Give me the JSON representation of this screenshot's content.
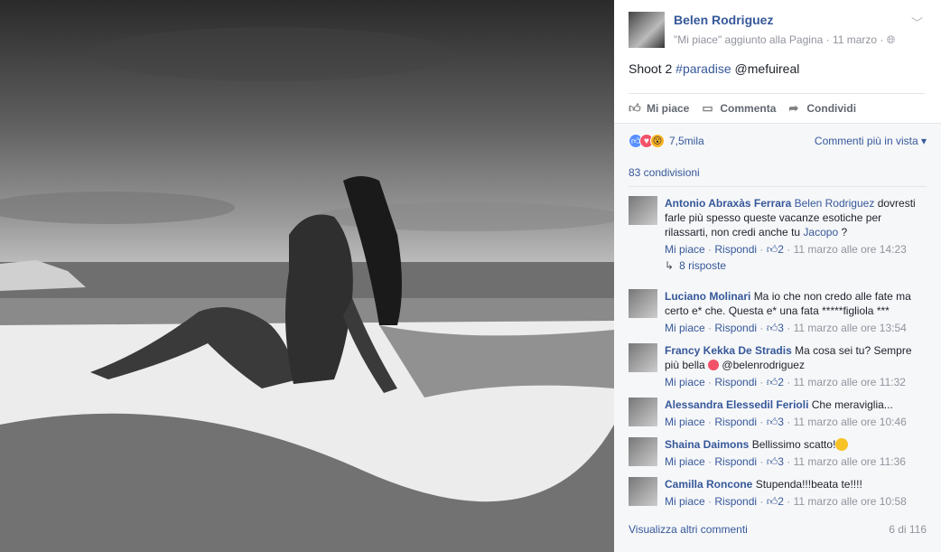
{
  "post": {
    "author": "Belen Rodriguez",
    "meta": "\"Mi piace\" aggiunto alla Pagina · 11 marzo · ",
    "text_prefix": "Shoot 2 ",
    "hashtag": "#paradise",
    "mention": " @mefuireal"
  },
  "actions": {
    "like": "Mi piace",
    "comment": "Commenta",
    "share": "Condividi"
  },
  "reactions": {
    "count": "7,5mila",
    "sort": "Commenti più in vista ▾"
  },
  "shares": "83 condivisioni",
  "comments": [
    {
      "name": "Antonio Abraxàs Ferrara",
      "text_tag": "Belen Rodriguez",
      "text": "dovresti farle più spesso queste vacanze esotiche per rilassarti, non credi anche tu ",
      "text_link": "Jacopo",
      "text_tail": " ?",
      "likes": "2",
      "time": "11 marzo alle ore 14:23",
      "replies": "8 risposte"
    },
    {
      "name": "Luciano Molinari",
      "text": "Ma io che non credo alle fate ma certo e* che. Questa e* una fata *****figliola ***",
      "likes": "3",
      "time": "11 marzo alle ore 13:54"
    },
    {
      "name": "Francy Kekka De Stradis",
      "text": "Ma cosa sei tu? Sempre più bella ",
      "text_tail": " @belenrodriguez",
      "likes": "2",
      "time": "11 marzo alle ore 11:32"
    },
    {
      "name": "Alessandra Elessedil Ferioli",
      "text": "Che meraviglia...",
      "likes": "3",
      "time": "11 marzo alle ore 10:46"
    },
    {
      "name": "Shaina Daimons",
      "text": "Bellissimo scatto!",
      "likes": "3",
      "time": "11 marzo alle ore 11:36"
    },
    {
      "name": "Camilla Roncone",
      "text": "Stupenda!!!beata te!!!!",
      "likes": "2",
      "time": "11 marzo alle ore 10:58"
    }
  ],
  "footer": {
    "more": "Visualizza altri commenti",
    "count": "6 di 116"
  },
  "labels": {
    "like": "Mi piace",
    "reply": "Rispondi",
    "sep": " · "
  },
  "colors": {
    "link": "#365899",
    "meta": "#90949c"
  }
}
